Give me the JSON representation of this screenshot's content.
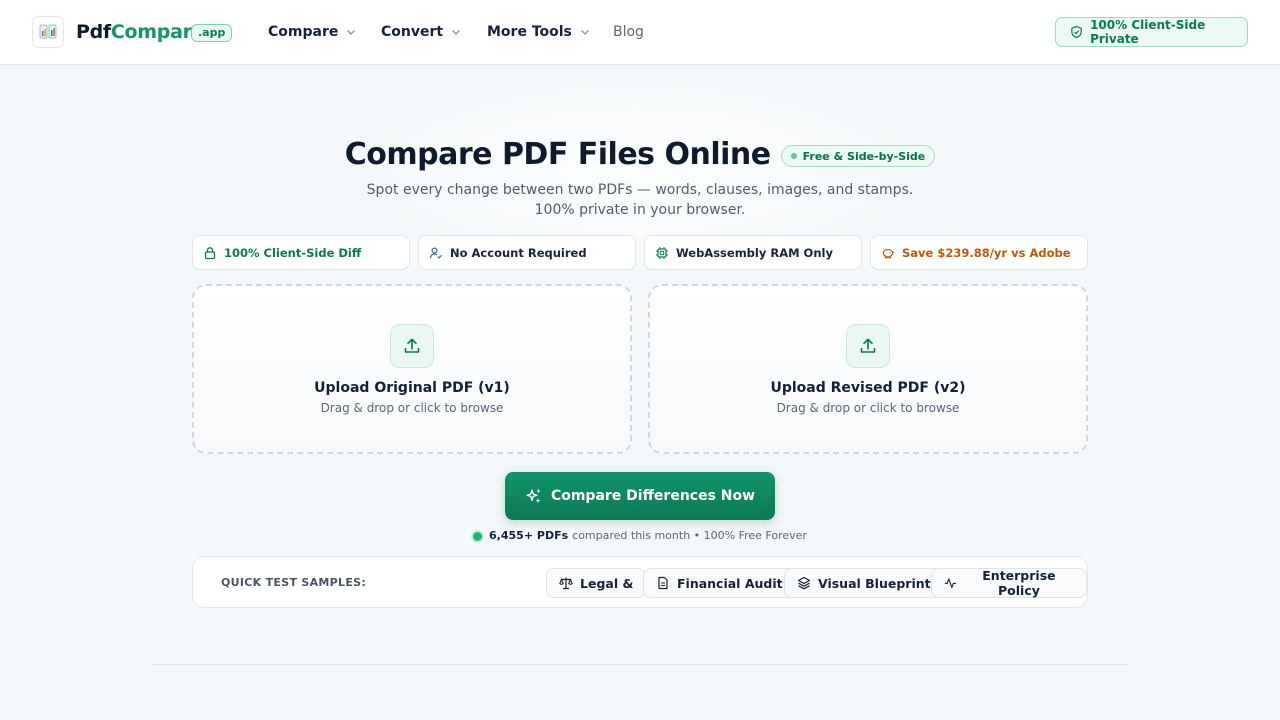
{
  "header": {
    "brand_part1": "Pdf",
    "brand_part2": "Compare",
    "brand_badge": ".app",
    "nav": [
      {
        "label": "Compare"
      },
      {
        "label": "Convert"
      },
      {
        "label": "More Tools"
      }
    ],
    "blog_label": "Blog",
    "private_pill": "100% Client-Side Private"
  },
  "hero": {
    "title": "Compare PDF Files Online",
    "badge": "Free & Side-by-Side",
    "subtitle_line1": "Spot every change between two PDFs — words, clauses, images, and stamps.",
    "subtitle_line2": "100% private in your browser."
  },
  "features": [
    {
      "label": "100% Client-Side Diff",
      "icon": "lock-icon"
    },
    {
      "label": "No Account Required",
      "icon": "user-check-icon"
    },
    {
      "label": "WebAssembly RAM Only",
      "icon": "chip-icon"
    },
    {
      "label": "Save $239.88/yr vs Adobe",
      "icon": "piggy-bank-icon"
    }
  ],
  "uploads": [
    {
      "label": "Upload Original PDF (v1)",
      "hint": "Drag & drop or click to browse"
    },
    {
      "label": "Upload Revised PDF (v2)",
      "hint": "Drag & drop or click to browse"
    }
  ],
  "cta": {
    "label": "Compare Differences Now"
  },
  "stats": {
    "count": "6,455+ PDFs",
    "text": "compared this month • 100% Free Forever"
  },
  "samples": {
    "label": "QUICK TEST SAMPLES:",
    "items": [
      {
        "label": "Legal &",
        "icon": "scale-icon"
      },
      {
        "label": "Financial Audit",
        "icon": "document-icon"
      },
      {
        "label": "Visual Blueprint",
        "icon": "layers-icon"
      },
      {
        "label": "Enterprise Policy",
        "icon": "activity-icon"
      }
    ]
  },
  "colors": {
    "accent": "#14966a",
    "accent_dark": "#0b7a55",
    "warning": "#c0570c"
  }
}
